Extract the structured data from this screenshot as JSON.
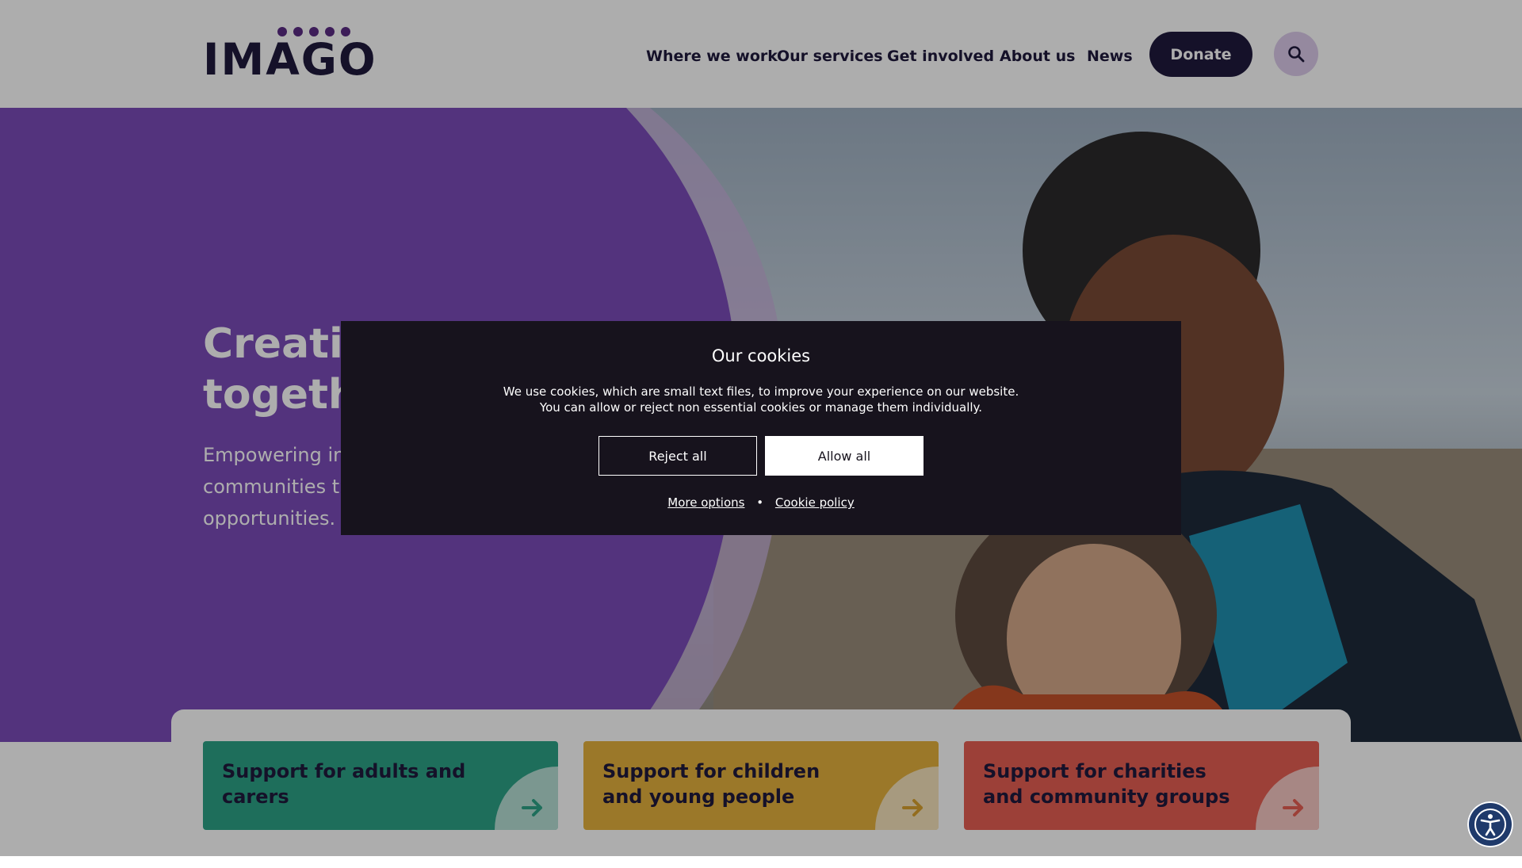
{
  "header": {
    "logo_text": "IMAGO",
    "nav": [
      {
        "label": "Where we work"
      },
      {
        "label": "Our services"
      },
      {
        "label": "Get involved"
      },
      {
        "label": "About us"
      },
      {
        "label": "News"
      }
    ],
    "donate_label": "Donate",
    "search_icon": "search-icon"
  },
  "hero": {
    "title": "Creating change together",
    "subtitle": "Empowering individuals, families and communities through support and opportunities."
  },
  "cards": [
    {
      "title": "Support for adults and carers",
      "color": "#2da387",
      "arrow_color": "#2da387"
    },
    {
      "title": "Support for children and young people",
      "color": "#e5b13d",
      "arrow_color": "#d9a12f"
    },
    {
      "title": "Support for charities and community groups",
      "color": "#e65f53",
      "arrow_color": "#e65f53"
    }
  ],
  "cookie": {
    "title": "Our cookies",
    "text_line1": "We use cookies, which are small text files, to improve your experience on our website.",
    "text_line2": "You can allow or reject non essential cookies or manage them individually.",
    "reject_label": "Reject all",
    "allow_label": "Allow all",
    "more_options_label": "More options",
    "separator": "•",
    "policy_label": "Cookie policy"
  },
  "accessibility": {
    "icon": "accessibility-icon"
  },
  "colors": {
    "brand_dark": "#1f1a3d",
    "brand_purple": "#7b4cb8",
    "accent_lilac": "#dccbea"
  }
}
